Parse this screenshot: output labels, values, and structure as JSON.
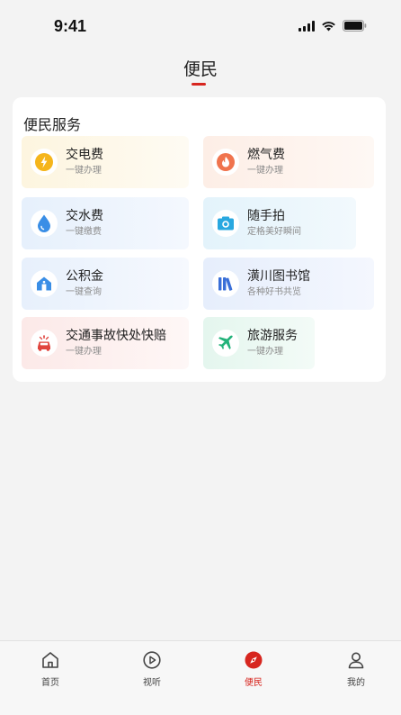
{
  "status_bar": {
    "time": "9:41"
  },
  "header": {
    "title": "便民"
  },
  "card": {
    "title": "便民服务",
    "items": [
      {
        "name": "交电费",
        "sub": "一键办理",
        "icon": "lightning-icon",
        "color": "#f5b51b"
      },
      {
        "name": "燃气费",
        "sub": "一键办理",
        "icon": "flame-icon",
        "color": "#f0744e"
      },
      {
        "name": "交水费",
        "sub": "一键缴费",
        "icon": "water-drop-icon",
        "color": "#3a8ee6"
      },
      {
        "name": "随手拍",
        "sub": "定格美好瞬间",
        "icon": "camera-icon",
        "color": "#29a8e0"
      },
      {
        "name": "公积金",
        "sub": "一键查询",
        "icon": "home-icon",
        "color": "#3a8ee6"
      },
      {
        "name": "潢川图书馆",
        "sub": "各种好书共览",
        "icon": "books-icon",
        "color": "#3a6fd8"
      },
      {
        "name": "交通事故快处快赔",
        "sub": "一键办理",
        "icon": "car-accident-icon",
        "color": "#e0453e"
      },
      {
        "name": "旅游服务",
        "sub": "一键办理",
        "icon": "airplane-icon",
        "color": "#23b27a"
      }
    ]
  },
  "bottom_nav": [
    {
      "label": "首页",
      "icon": "home-outline-icon",
      "active": false
    },
    {
      "label": "视听",
      "icon": "play-circle-icon",
      "active": false
    },
    {
      "label": "便民",
      "icon": "compass-icon",
      "active": true
    },
    {
      "label": "我的",
      "icon": "user-icon",
      "active": false
    }
  ],
  "colors": {
    "accent": "#d7261f"
  }
}
